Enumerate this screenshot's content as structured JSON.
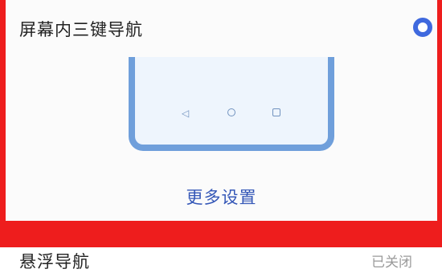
{
  "three_key_option": {
    "title": "屏幕内三键导航",
    "selected": true,
    "accent_color": "#3f69de"
  },
  "more_settings": {
    "label": "更多设置"
  },
  "floating_nav": {
    "title": "悬浮导航",
    "status": "已关闭"
  },
  "highlight_color": "#ee1d1d"
}
